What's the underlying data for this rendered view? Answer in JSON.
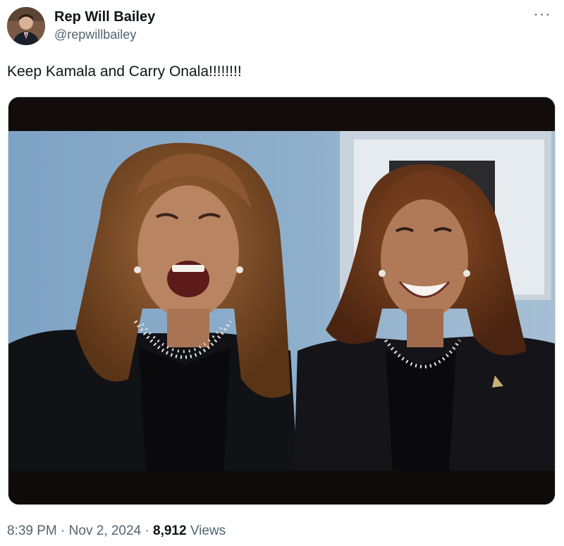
{
  "author": {
    "display_name": "Rep Will Bailey",
    "handle": "@repwillbailey"
  },
  "more_icon": "more-horizontal-icon",
  "tweet": {
    "text": "Keep Kamala and Carry Onala!!!!!!!!"
  },
  "media": {
    "kind": "photo"
  },
  "meta": {
    "time": "8:39 PM",
    "sep1": " · ",
    "date": "Nov 2, 2024",
    "sep2": " · ",
    "views_count": "8,912",
    "views_label": " Views"
  },
  "colors": {
    "text_primary": "#0f1419",
    "text_secondary": "#536471",
    "border": "#cfd9de"
  }
}
